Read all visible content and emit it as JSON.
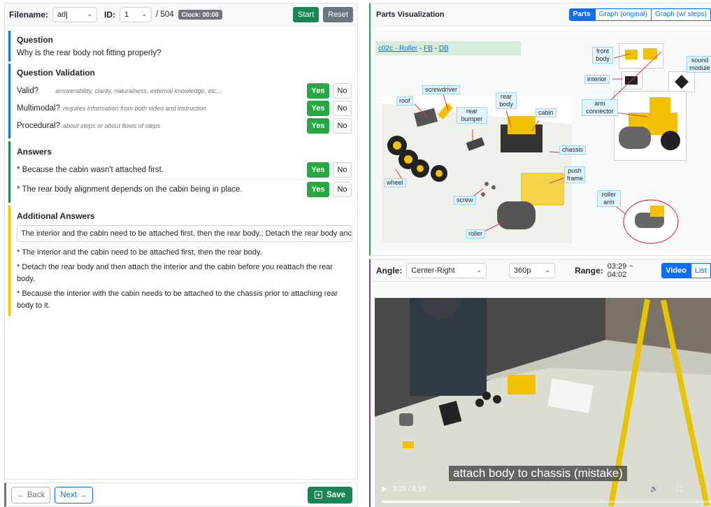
{
  "toolbar": {
    "filename_label": "Filename:",
    "filename_value": "adj",
    "id_label": "ID:",
    "id_value": "1",
    "id_total": "/ 504",
    "clock": "Clock: 00:00",
    "start_label": "Start",
    "reset_label": "Reset"
  },
  "question": {
    "title": "Question",
    "text": "Why is the rear body not fitting properly?"
  },
  "validation": {
    "title": "Question Validation",
    "rows": [
      {
        "name": "Valid?",
        "hint": "answerability, clarity, naturalness, external knowledge, etc...",
        "yes": "Yes",
        "no": "No"
      },
      {
        "name": "Multimodal?",
        "hint": "requires information from both video and instruction",
        "yes": "Yes",
        "no": "No"
      },
      {
        "name": "Procedural?",
        "hint": "about steps or about flows of steps",
        "yes": "Yes",
        "no": "No"
      }
    ]
  },
  "answers": {
    "title": "Answers",
    "rows": [
      {
        "text": "* Because the cabin wasn't attached first.",
        "yes": "Yes",
        "no": "No"
      },
      {
        "text": "* The rear body alignment depends on the cabin being in place.",
        "yes": "Yes",
        "no": "No"
      }
    ]
  },
  "additional": {
    "title": "Additional Answers",
    "input_value": "The interior and the cabin need to be attached first, then the rear body.; Detach the rear body anc",
    "items": [
      "* The interior and the cabin need to be attached first, then the rear body.",
      "* Detach the rear body and then attach the interior and the cabin before you reattach the rear body.",
      "* Because the interior with the cabin needs to be attached to the chassis prior to attaching rear body to it."
    ]
  },
  "nav": {
    "back_label": "← Back",
    "next_label": "Next →",
    "save_label": "Save"
  },
  "parts": {
    "title": "Parts Visualization",
    "tabs": [
      "Parts",
      "Graph (original)",
      "Graph (w/ steps)"
    ],
    "source_link": "c02c - Roller",
    "source_sep1": " - ",
    "fb_link": "FB",
    "source_sep2": " - ",
    "db_link": "DB",
    "labels": {
      "roof": "roof",
      "screwdriver": "screwdriver",
      "rear_body": "rear body",
      "rear_bumper": "rear bumper",
      "cabin": "cabin",
      "chassis": "chassis",
      "push_frame": "push frame",
      "wheel": "wheel",
      "screw": "screw",
      "roller": "roller",
      "front_body": "front body",
      "interior": "interior",
      "sound_module": "sound module",
      "arm_connector": "arm connector",
      "roller_arm": "roller arm"
    }
  },
  "video": {
    "angle_label": "Angle:",
    "angle_value": "Center-Right",
    "quality_value": "360p",
    "range_label": "Range:",
    "range_value": "03:29 ~ 04:02",
    "tab_video": "Video",
    "tab_list": "List",
    "caption": "attach body to chassis (mistake)",
    "time": "3:29 / 8:19",
    "progress": 0.42
  },
  "colors": {
    "primary": "#0d6efd",
    "success": "#198754",
    "yes_green": "#28a745",
    "warning": "#ffc107",
    "purple": "#6f42c1"
  }
}
